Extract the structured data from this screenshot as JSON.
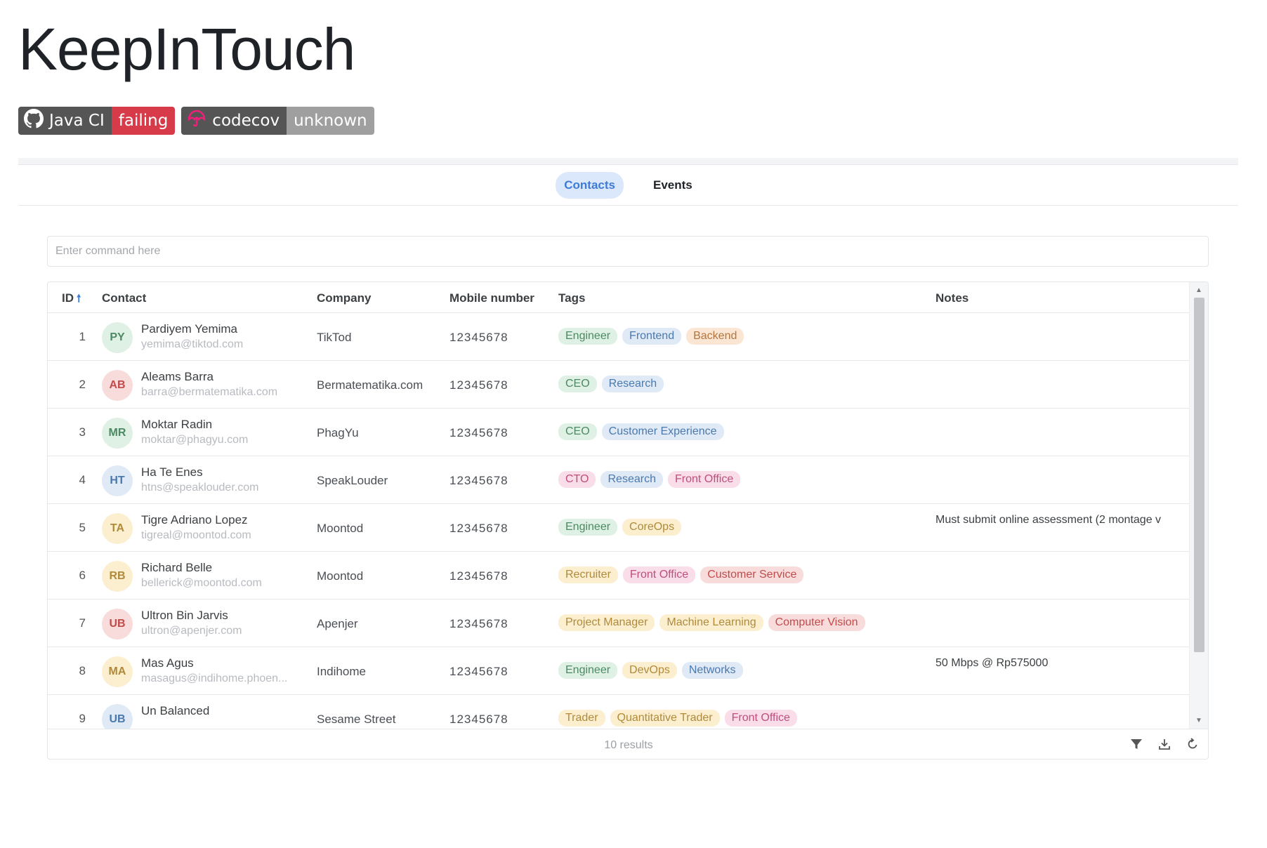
{
  "page": {
    "title": "KeepInTouch"
  },
  "badges": [
    {
      "label": "Java CI",
      "status": "failing",
      "icon": "github-icon",
      "status_color": "#d73a49"
    },
    {
      "label": "codecov",
      "status": "unknown",
      "icon": "codecov-umbrella-icon",
      "status_color": "#9f9f9f"
    }
  ],
  "nav": {
    "tabs": [
      "Contacts",
      "Events"
    ],
    "active": "Contacts"
  },
  "command": {
    "placeholder": "Enter command here",
    "value": ""
  },
  "table": {
    "columns": {
      "id": "ID",
      "contact": "Contact",
      "company": "Company",
      "mobile": "Mobile number",
      "tags": "Tags",
      "notes": "Notes"
    },
    "sort": {
      "column": "ID",
      "direction": "ascending"
    },
    "rows": [
      {
        "id": "1",
        "initials": "PY",
        "name": "Pardiyem Yemima",
        "email": "yemima@tiktod.com",
        "company": "TikTod",
        "mobile": "12345678",
        "tags": [
          {
            "text": "Engineer",
            "color": "green"
          },
          {
            "text": "Frontend",
            "color": "blue"
          },
          {
            "text": "Backend",
            "color": "orange"
          }
        ],
        "notes": "",
        "avatar_color": "green"
      },
      {
        "id": "2",
        "initials": "AB",
        "name": "Aleams Barra",
        "email": "barra@bermatematika.com",
        "company": "Bermatematika.com",
        "mobile": "12345678",
        "tags": [
          {
            "text": "CEO",
            "color": "green"
          },
          {
            "text": "Research",
            "color": "blue"
          }
        ],
        "notes": "",
        "avatar_color": "red"
      },
      {
        "id": "3",
        "initials": "MR",
        "name": "Moktar Radin",
        "email": "moktar@phagyu.com",
        "company": "PhagYu",
        "mobile": "12345678",
        "tags": [
          {
            "text": "CEO",
            "color": "green"
          },
          {
            "text": "Customer Experience",
            "color": "blue"
          }
        ],
        "notes": "",
        "avatar_color": "green"
      },
      {
        "id": "4",
        "initials": "HT",
        "name": "Ha Te Enes",
        "email": "htns@speaklouder.com",
        "company": "SpeakLouder",
        "mobile": "12345678",
        "tags": [
          {
            "text": "CTO",
            "color": "pink"
          },
          {
            "text": "Research",
            "color": "blue"
          },
          {
            "text": "Front Office",
            "color": "pink"
          }
        ],
        "notes": "",
        "avatar_color": "blue"
      },
      {
        "id": "5",
        "initials": "TA",
        "name": "Tigre Adriano Lopez",
        "email": "tigreal@moontod.com",
        "company": "Moontod",
        "mobile": "12345678",
        "tags": [
          {
            "text": "Engineer",
            "color": "green"
          },
          {
            "text": "CoreOps",
            "color": "yellow"
          }
        ],
        "notes": "Must submit online assessment (2 montage v",
        "avatar_color": "yellow"
      },
      {
        "id": "6",
        "initials": "RB",
        "name": "Richard Belle",
        "email": "bellerick@moontod.com",
        "company": "Moontod",
        "mobile": "12345678",
        "tags": [
          {
            "text": "Recruiter",
            "color": "yellow"
          },
          {
            "text": "Front Office",
            "color": "pink"
          },
          {
            "text": "Customer Service",
            "color": "red"
          }
        ],
        "notes": "",
        "avatar_color": "yellow"
      },
      {
        "id": "7",
        "initials": "UB",
        "name": "Ultron Bin Jarvis",
        "email": "ultron@apenjer.com",
        "company": "Apenjer",
        "mobile": "12345678",
        "tags": [
          {
            "text": "Project Manager",
            "color": "yellow"
          },
          {
            "text": "Machine Learning",
            "color": "yellow"
          },
          {
            "text": "Computer Vision",
            "color": "red"
          }
        ],
        "notes": "",
        "avatar_color": "red"
      },
      {
        "id": "8",
        "initials": "MA",
        "name": "Mas Agus",
        "email": "masagus@indihome.phoen...",
        "company": "Indihome",
        "mobile": "12345678",
        "tags": [
          {
            "text": "Engineer",
            "color": "green"
          },
          {
            "text": "DevOps",
            "color": "yellow"
          },
          {
            "text": "Networks",
            "color": "blue"
          }
        ],
        "notes": "50 Mbps @ Rp575000",
        "avatar_color": "yellow"
      },
      {
        "id": "9",
        "initials": "UB",
        "name": "Un Balanced",
        "email": "",
        "company": "Sesame Street",
        "mobile": "12345678",
        "tags": [
          {
            "text": "Trader",
            "color": "yellow"
          },
          {
            "text": "Quantitative Trader",
            "color": "yellow"
          },
          {
            "text": "Front Office",
            "color": "pink"
          }
        ],
        "notes": "",
        "avatar_color": "blue"
      }
    ]
  },
  "footer": {
    "results": "10 results",
    "icons": [
      "filter-icon",
      "download-icon",
      "refresh-icon"
    ]
  },
  "colors": {
    "accent": "#3e7bd6",
    "failing": "#d73a49",
    "unknown": "#9f9f9f"
  }
}
